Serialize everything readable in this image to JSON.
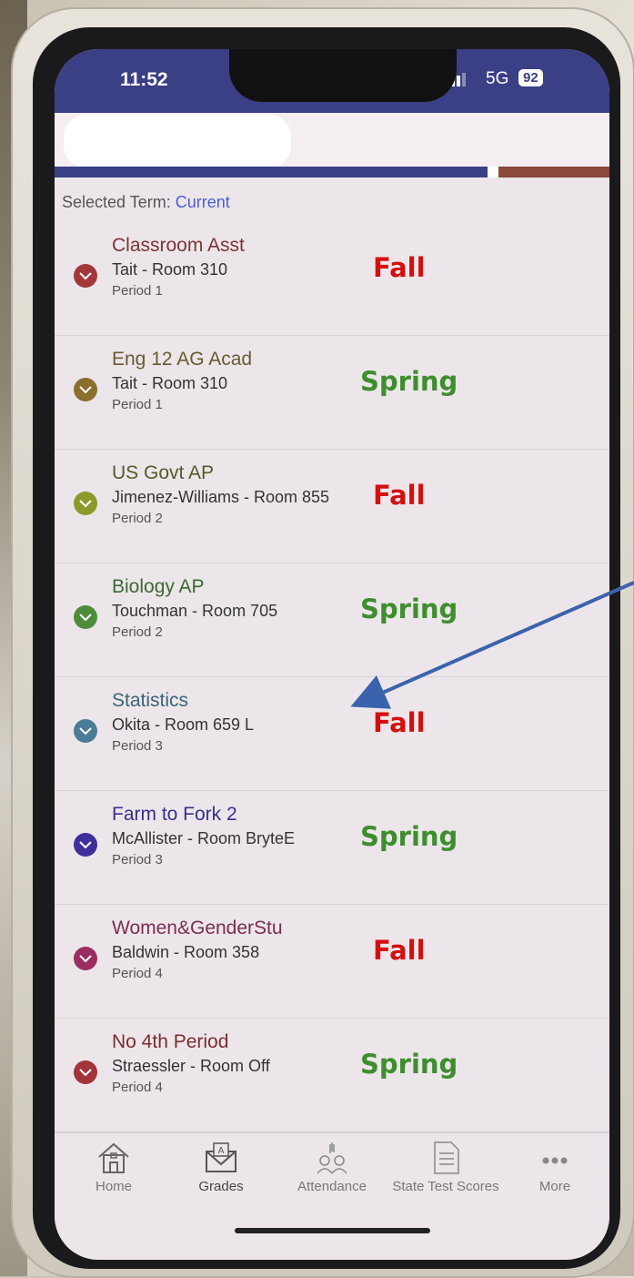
{
  "status_bar": {
    "time": "11:52",
    "network": "5G",
    "battery": "92"
  },
  "selected_term": {
    "label": "Selected Term:",
    "value": "Current"
  },
  "courses": [
    {
      "title": "Classroom Asst",
      "teacher": "Tait - Room 310",
      "period": "Period 1",
      "color": "#a3383a",
      "title_color": "#7a3535",
      "term": "Fall"
    },
    {
      "title": "Eng 12 AG Acad",
      "teacher": "Tait - Room 310",
      "period": "Period 1",
      "color": "#8a6e2e",
      "title_color": "#6a5a30",
      "term": "Spring"
    },
    {
      "title": "US Govt AP",
      "teacher": "Jimenez-Williams - Room 855",
      "period": "Period 2",
      "color": "#8b9a2a",
      "title_color": "#555a2a",
      "term": "Fall"
    },
    {
      "title": "Biology AP",
      "teacher": "Touchman - Room 705",
      "period": "Period 2",
      "color": "#4d8d3a",
      "title_color": "#3a6a30",
      "term": "Spring"
    },
    {
      "title": "Statistics",
      "teacher": "Okita - Room 659 L",
      "period": "Period 3",
      "color": "#4a7c96",
      "title_color": "#3a6478",
      "term": "Fall"
    },
    {
      "title": "Farm to Fork 2",
      "teacher": "McAllister - Room BryteE",
      "period": "Period 3",
      "color": "#3f2f9a",
      "title_color": "#35308a",
      "term": "Spring"
    },
    {
      "title": "Women&GenderStu",
      "teacher": "Baldwin - Room 358",
      "period": "Period 4",
      "color": "#9a2e62",
      "title_color": "#7a2d55",
      "term": "Fall"
    },
    {
      "title": "No 4th Period",
      "teacher": "Straessler - Room Off",
      "period": "Period 4",
      "color": "#a3343a",
      "title_color": "#7a2d30",
      "term": "Spring"
    }
  ],
  "term_colors": {
    "Fall": "#d40f0f",
    "Spring": "#3e8e2e"
  },
  "tabs": [
    {
      "label": "Home",
      "icon": "house-icon"
    },
    {
      "label": "Grades",
      "icon": "grade-envelope-icon"
    },
    {
      "label": "Attendance",
      "icon": "raised-hands-icon"
    },
    {
      "label": "State Test Scores",
      "icon": "document-icon"
    },
    {
      "label": "More",
      "icon": "more-dots-icon"
    }
  ],
  "colors": {
    "status_bar": "#3b3f86",
    "accent": "#4a5ed1",
    "annotation_arrow": "#3b62ad"
  }
}
